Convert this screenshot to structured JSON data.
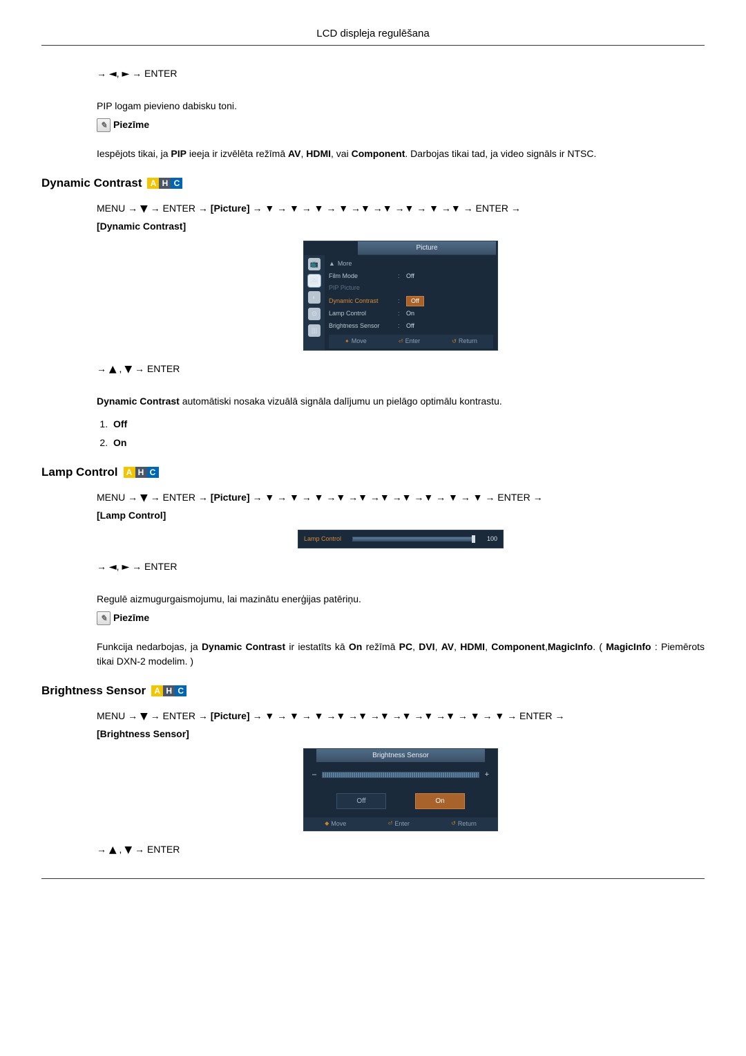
{
  "page_title": "LCD displeja regulēšana",
  "intro": {
    "nav_pre": "→ ",
    "nav_left": "◄",
    "nav_comma": ", ",
    "nav_right": "►",
    "nav_post": " → ENTER",
    "line1": "PIP logam pievieno dabisku toni.",
    "note_label": "Piezīme",
    "note_text_pre": "Iespējots tikai, ja ",
    "note_bold1": "PIP",
    "note_text_mid": " ieeja ir izvēlēta režīmā ",
    "note_bold2": "AV",
    "note_text_c1": ", ",
    "note_bold3": "HDMI",
    "note_text_c2": ", vai ",
    "note_bold4": "Component",
    "note_text_end": ". Darbojas tikai tad, ja video signāls ir NTSC."
  },
  "dc": {
    "heading": "Dynamic Contrast",
    "path_pre": "MENU → ",
    "path_down": "▼",
    "path_enter": " → ENTER → ",
    "path_picture": "[Picture]",
    "path_arrows": " → ▼ → ▼ → ▼ → ▼ →▼ →▼ →▼ → ▼ →▼ → ENTER → ",
    "path_end": "[Dynamic Contrast]",
    "osd": {
      "title": "Picture",
      "more": "More",
      "rows": [
        {
          "label": "Film Mode",
          "value": "Off"
        },
        {
          "label": "PIP Picture",
          "value": ""
        },
        {
          "label": "Dynamic Contrast",
          "value": "Off"
        },
        {
          "label": "Lamp Control",
          "value": "On"
        },
        {
          "label": "Brightness Sensor",
          "value": "Off"
        }
      ],
      "footer": {
        "move": "Move",
        "enter": "Enter",
        "return": "Return"
      }
    },
    "nav2_pre": "→ ",
    "nav2_up": "▲",
    "nav2_comma": " , ",
    "nav2_down": "▼",
    "nav2_post": " → ENTER",
    "desc_bold": "Dynamic Contrast",
    "desc_rest": " automātiski nosaka vizuālā signāla dalījumu un pielāgo optimālu kontrastu.",
    "opt1": "Off",
    "opt2": "On"
  },
  "lc": {
    "heading": "Lamp Control",
    "path_pre": "MENU → ",
    "path_down": "▼",
    "path_enter": " → ENTER → ",
    "path_picture": "[Picture]",
    "path_arrows": " → ▼ → ▼ → ▼ →▼ →▼ →▼ →▼ →▼ → ▼ → ▼ → ENTER → ",
    "path_end": "[Lamp Control]",
    "osd": {
      "label": "Lamp Control",
      "value": "100"
    },
    "nav2_pre": "→ ",
    "nav2_left": "◄",
    "nav2_comma": ", ",
    "nav2_right": "►",
    "nav2_post": " → ENTER",
    "desc": "Regulē aizmugurgaismojumu, lai mazinātu enerģijas patēriņu.",
    "note_label": "Piezīme",
    "note_p1": "Funkcija nedarbojas, ja ",
    "note_b1": "Dynamic Contrast",
    "note_p2": " ir iestatīts kā ",
    "note_b2": "On",
    "note_p3": " režīmā ",
    "note_b3": "PC",
    "note_c1": ", ",
    "note_b4": "DVI",
    "note_c2": ", ",
    "note_b5": "AV",
    "note_c3": ", ",
    "note_b6": "HDMI",
    "note_c4": ", ",
    "note_b7": "Component",
    "note_c5": ",",
    "note_b8": "MagicInfo",
    "note_p4": ". ( ",
    "note_b9": "MagicInfo",
    "note_p5": " : Piemērots tikai DXN-2 modelim. )"
  },
  "bs": {
    "heading": "Brightness Sensor",
    "path_pre": "MENU → ",
    "path_down": "▼",
    "path_enter": " → ENTER → ",
    "path_picture": "[Picture]",
    "path_arrows": " → ▼ → ▼ → ▼ →▼ →▼ →▼ →▼ →▼ →▼ → ▼ → ▼ → ENTER → ",
    "path_end": "[Brightness Sensor]",
    "osd": {
      "title": "Brightness Sensor",
      "minus": "–",
      "plus": "+",
      "off": "Off",
      "on": "On",
      "footer": {
        "move": "Move",
        "enter": "Enter",
        "return": "Return"
      }
    },
    "nav2_pre": "→ ",
    "nav2_up": "▲",
    "nav2_comma": " , ",
    "nav2_down": "▼",
    "nav2_post": " → ENTER"
  },
  "badges": {
    "A": "A",
    "H": "H",
    "C": "C"
  }
}
